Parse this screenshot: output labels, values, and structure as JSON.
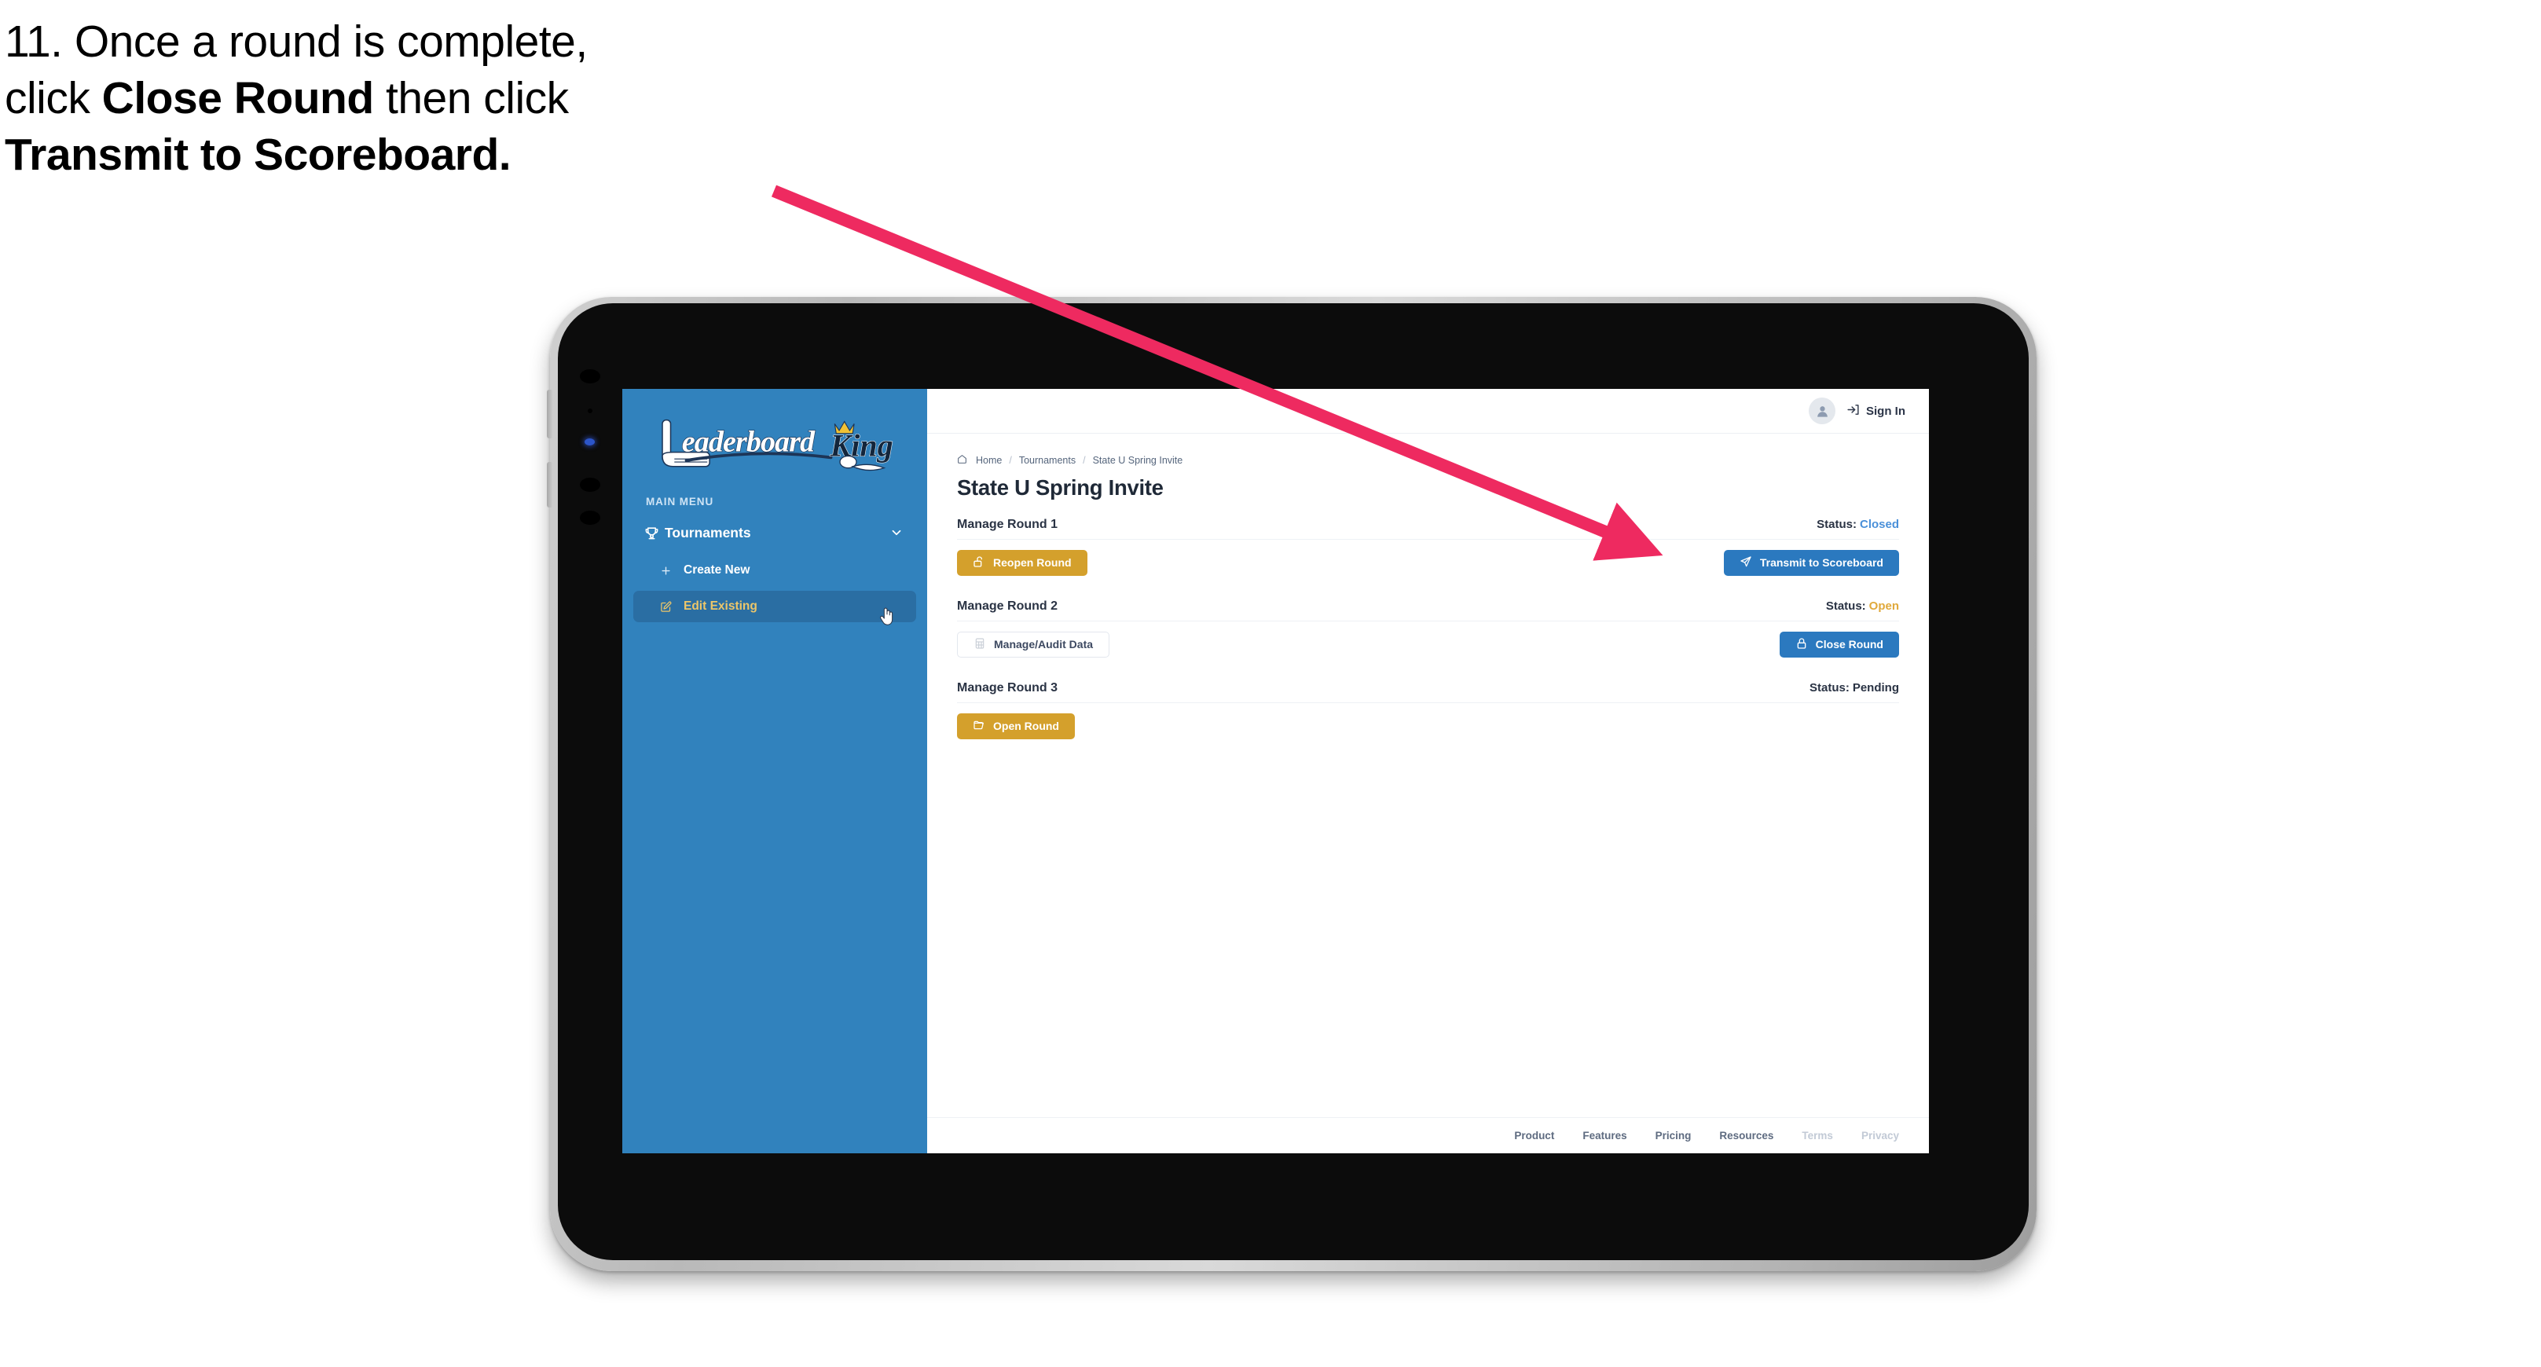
{
  "caption": {
    "line1_plain": "11. Once a round is complete,",
    "line2_pre": "click ",
    "line2_bold": "Close Round",
    "line2_post": " then click",
    "line3_bold": "Transmit to Scoreboard."
  },
  "sidebar": {
    "logo_text_primary": "Leaderboard",
    "logo_text_secondary": "King",
    "section_label": "MAIN MENU",
    "nav": [
      {
        "label": "Tournaments",
        "icon": "trophy-icon",
        "expand_icon": "chevron-down-icon"
      }
    ],
    "sub_items": [
      {
        "label": "Create New",
        "icon": "plus-icon",
        "active": false
      },
      {
        "label": "Edit Existing",
        "icon": "edit-square-icon",
        "active": true
      }
    ],
    "cursor_icon": "hand-pointer-cursor",
    "bg_color": "#3182bd",
    "active_bg_color": "#2a6ea3",
    "active_text_color": "#ecc66a"
  },
  "topbar": {
    "avatar_icon": "user-avatar-icon",
    "signin_icon": "login-arrow-icon",
    "signin_label": "Sign In"
  },
  "breadcrumb": {
    "home_icon": "home-icon",
    "items": [
      "Home",
      "Tournaments",
      "State U Spring Invite"
    ],
    "separator": "/"
  },
  "page_title": "State U Spring Invite",
  "rounds": [
    {
      "name": "Manage Round 1",
      "status_label": "Status:",
      "status_value": "Closed",
      "status_color": "#4a90d9",
      "left_button": {
        "label": "Reopen Round",
        "icon": "unlock-icon",
        "style": "gold"
      },
      "right_button": {
        "label": "Transmit to Scoreboard",
        "icon": "paper-plane-icon",
        "style": "blue"
      }
    },
    {
      "name": "Manage Round 2",
      "status_label": "Status:",
      "status_value": "Open",
      "status_color": "#e0a93b",
      "left_button": {
        "label": "Manage/Audit Data",
        "icon": "spreadsheet-icon",
        "style": "ghost"
      },
      "right_button": {
        "label": "Close Round",
        "icon": "lock-icon",
        "style": "blue"
      }
    },
    {
      "name": "Manage Round 3",
      "status_label": "Status:",
      "status_value": "Pending",
      "status_color": "#2a3344",
      "left_button": {
        "label": "Open Round",
        "icon": "folder-open-icon",
        "style": "gold"
      },
      "right_button": null
    }
  ],
  "footer": {
    "links": [
      {
        "label": "Product",
        "muted": false
      },
      {
        "label": "Features",
        "muted": false
      },
      {
        "label": "Pricing",
        "muted": false
      },
      {
        "label": "Resources",
        "muted": false
      },
      {
        "label": "Terms",
        "muted": true
      },
      {
        "label": "Privacy",
        "muted": true
      }
    ]
  },
  "annotation": {
    "arrow_color": "#ee2a60",
    "target": "Transmit to Scoreboard button"
  }
}
